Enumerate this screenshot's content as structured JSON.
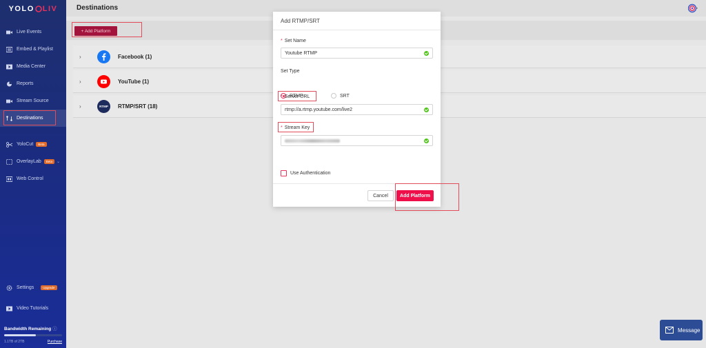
{
  "app": {
    "logo_left": "YOLO",
    "logo_right": "LIV"
  },
  "sidebar": {
    "items": [
      {
        "label": "Live Events",
        "icon": "video-camera-icon"
      },
      {
        "label": "Embed & Playlist",
        "icon": "playlist-icon"
      },
      {
        "label": "Media Center",
        "icon": "media-icon"
      },
      {
        "label": "Reports",
        "icon": "pie-chart-icon"
      },
      {
        "label": "Stream Source",
        "icon": "stream-source-icon"
      },
      {
        "label": "Destinations",
        "icon": "destinations-icon"
      }
    ],
    "tools": [
      {
        "label": "YoloCut",
        "badge": "Beta"
      },
      {
        "label": "OverlayLab",
        "badge": "Beta"
      },
      {
        "label": "Web Control"
      }
    ],
    "settings": {
      "label": "Settings",
      "badge": "Upgrade"
    },
    "tutorials": {
      "label": "Video Tutorials"
    },
    "bandwidth": {
      "title": "Bandwidth Remaining",
      "info_icon": "info-icon",
      "text": "1.1TB of 2TB",
      "link": "Purchase",
      "fraction": 0.55
    }
  },
  "header": {
    "title": "Destinations"
  },
  "toolbar": {
    "add_label": "+ Add Platform"
  },
  "destinations": [
    {
      "label": "Facebook (1)",
      "icon": "facebook-icon",
      "color": "#1877f2"
    },
    {
      "label": "YouTube (1)",
      "icon": "youtube-icon",
      "color": "#ff0000"
    },
    {
      "label": "RTMP/SRT (18)",
      "icon": "rtmp-icon",
      "color": "#1d2c5c",
      "icon_text": "RTMP"
    }
  ],
  "modal": {
    "title": "Add RTMP/SRT",
    "set_name_label": "Set Name",
    "set_name_value": "Youtube RTMP",
    "set_type_label": "Set Type",
    "type_options": [
      "RTMP",
      "SRT"
    ],
    "selected_type": "RTMP",
    "server_url_label": "Server URL",
    "server_url_value": "rtmp://a.rtmp.youtube.com/live2",
    "stream_key_label": "Stream Key",
    "use_auth_label": "Use Authentication",
    "cancel_label": "Cancel",
    "confirm_label": "Add Platform"
  },
  "message_widget": {
    "label": "Message"
  },
  "colors": {
    "accent": "#e8335c",
    "primary_button": "#ef0f4a",
    "add_button": "#a3143d",
    "highlight": "#e14b5a"
  }
}
